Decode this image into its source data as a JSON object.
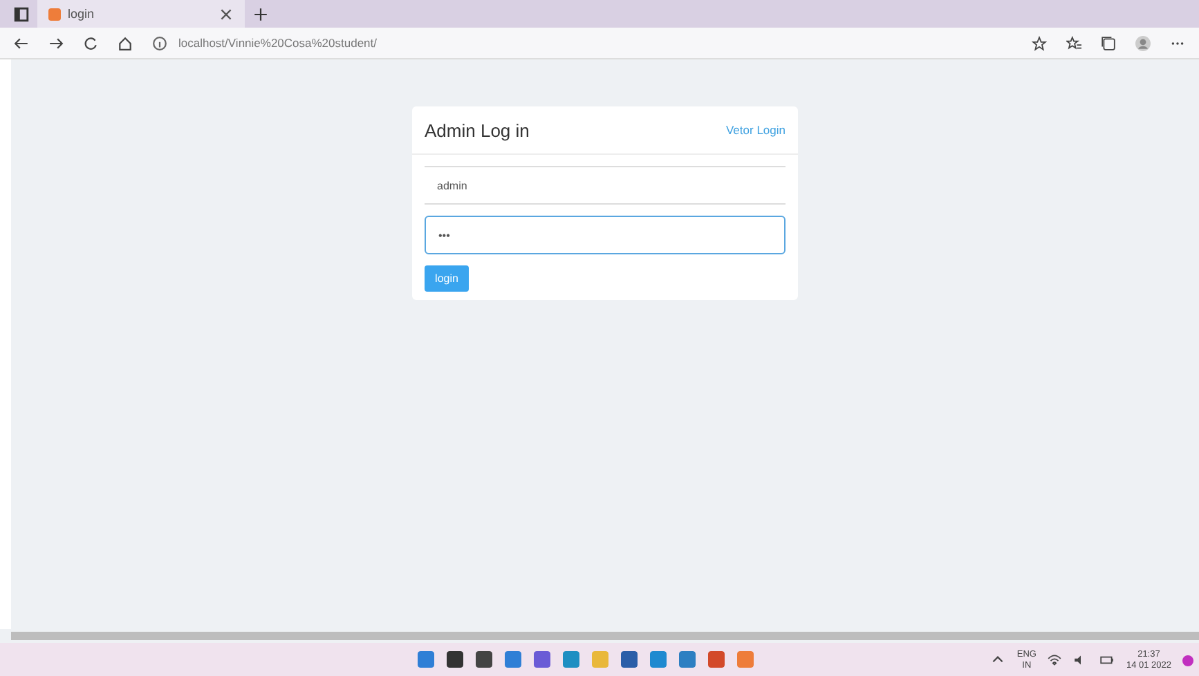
{
  "browser": {
    "tab": {
      "title": "login",
      "selected": true
    },
    "address": "localhost/Vinnie%20Cosa%20student/"
  },
  "login_card": {
    "title": "Admin Log in",
    "link": "Vetor Login",
    "fields": [
      {
        "value": "admin",
        "focused": false
      },
      {
        "value": "•••",
        "focused": true
      }
    ],
    "button": "login"
  },
  "taskbar": {
    "language": "ENG",
    "region": "IN",
    "time": "21:37",
    "date": "14 01 2022"
  }
}
